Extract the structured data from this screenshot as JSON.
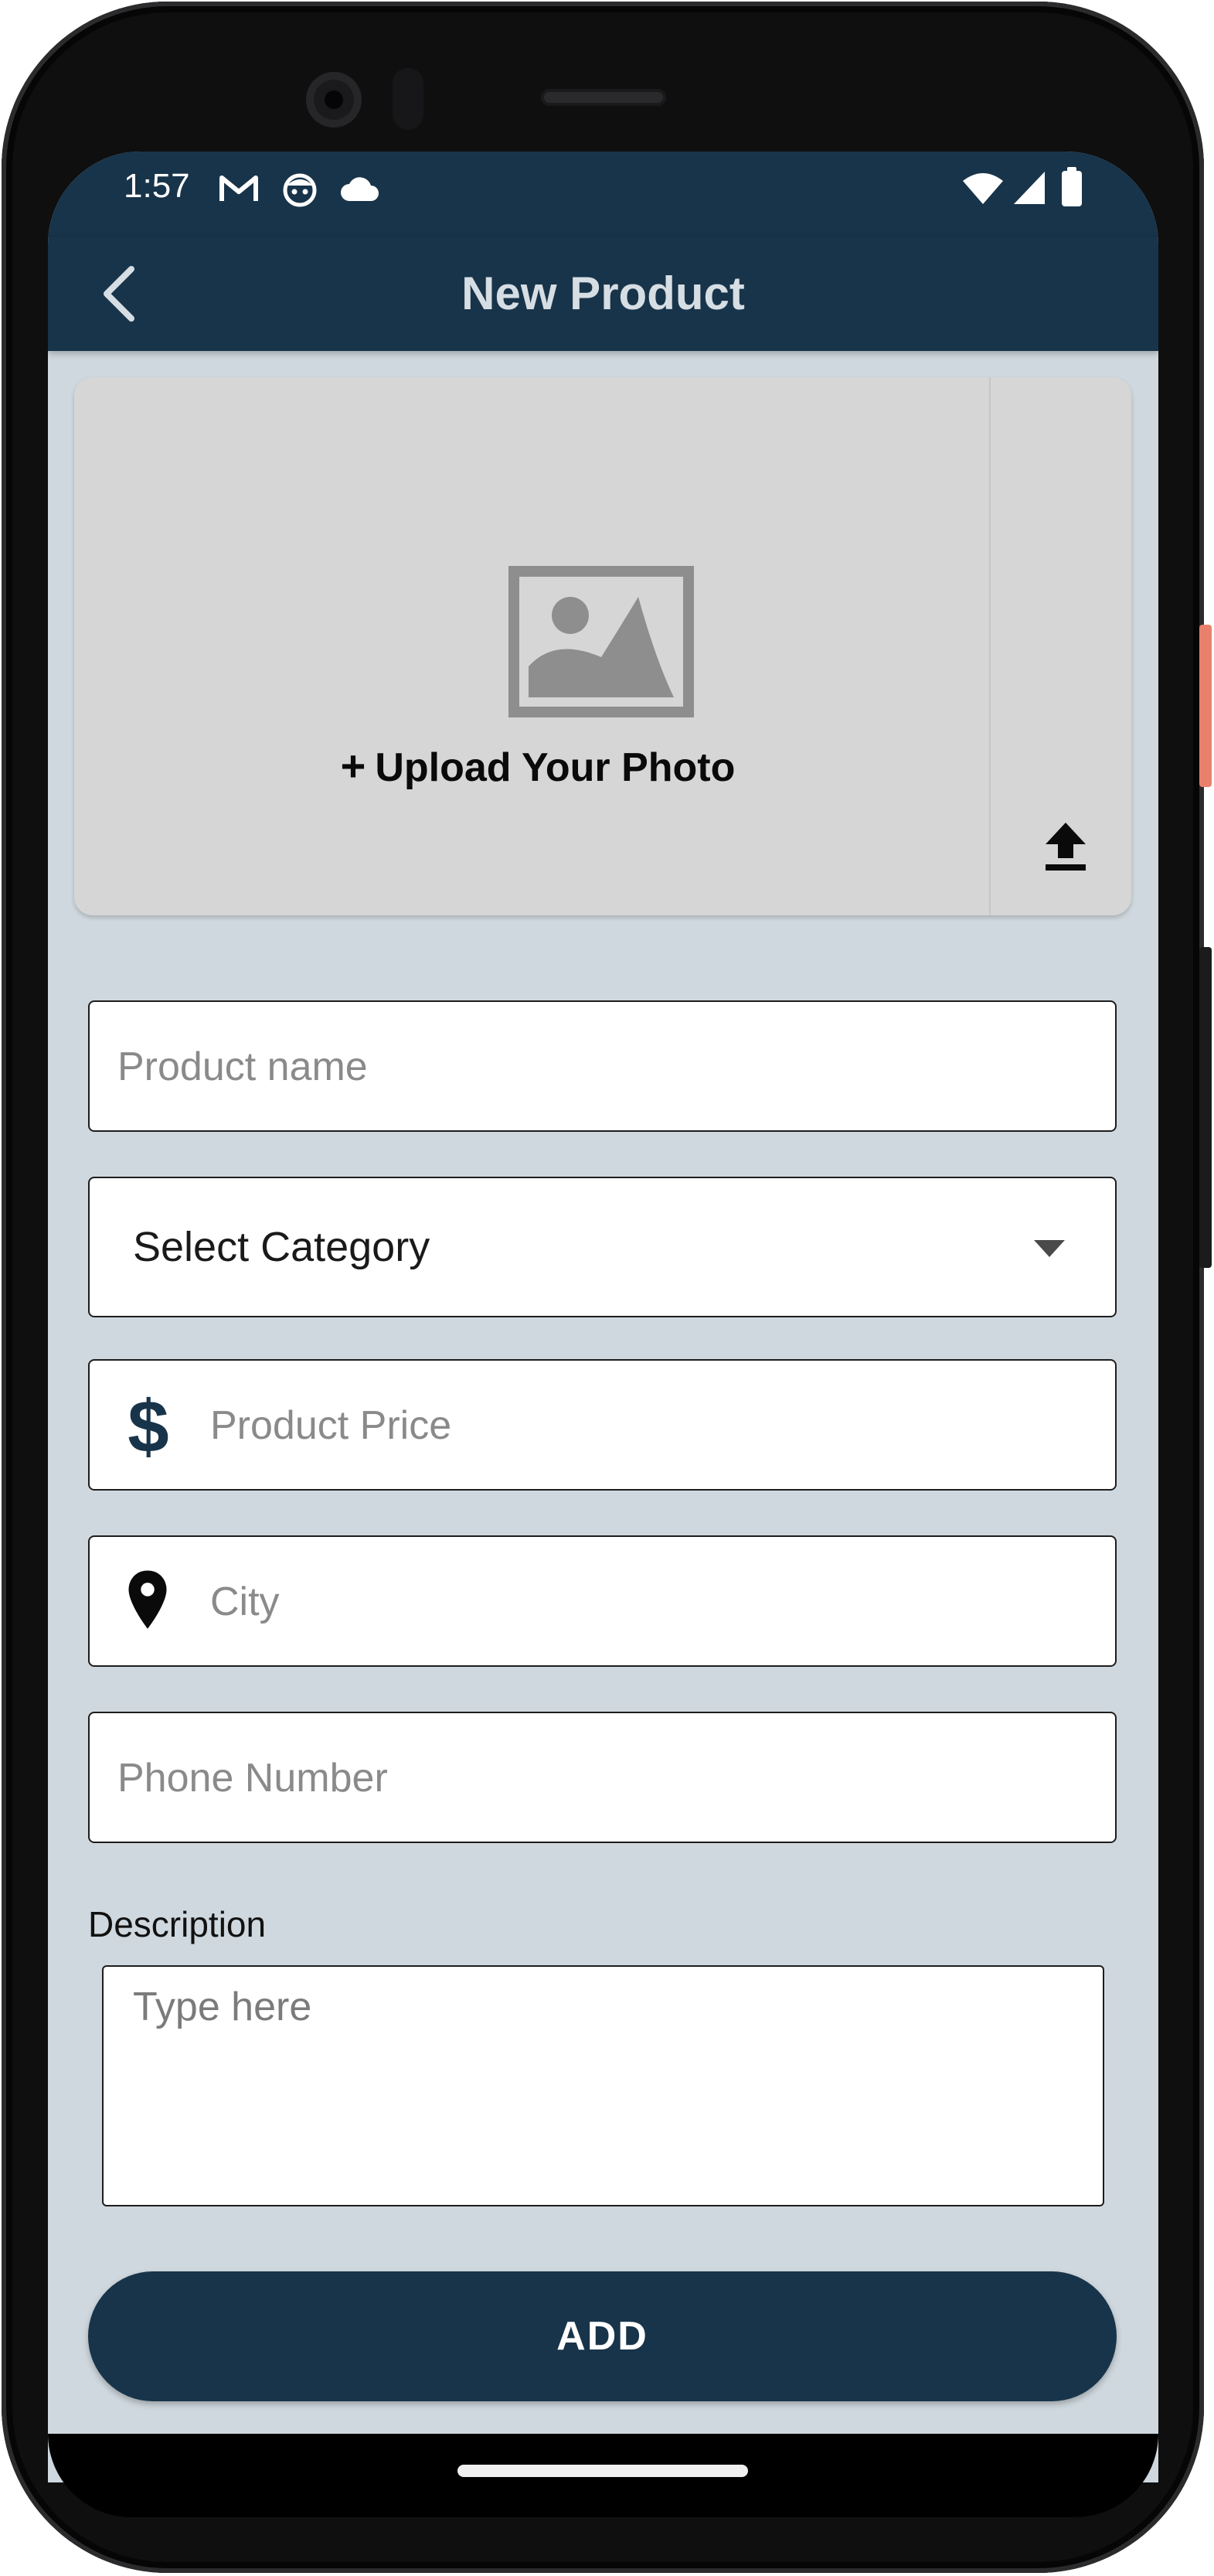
{
  "status_bar": {
    "time": "1:57",
    "left_icons": [
      "gmail-icon",
      "bot-face-icon",
      "cloud-icon"
    ],
    "right_icons": [
      "wifi-icon",
      "cell-signal-icon",
      "battery-icon"
    ]
  },
  "app_bar": {
    "title": "New Product",
    "back_icon": "chevron-left-icon"
  },
  "upload": {
    "label": "Upload Your Photo",
    "plus": "+",
    "image_icon": "image-placeholder-icon",
    "action_icon": "upload-arrow-icon"
  },
  "form": {
    "product_name": {
      "value": "",
      "placeholder": "Product name"
    },
    "category": {
      "selected": "Select Category",
      "icon": "dropdown-arrow-icon"
    },
    "price": {
      "value": "",
      "placeholder": "Product Price",
      "icon": "dollar-icon"
    },
    "city": {
      "value": "",
      "placeholder": "City",
      "icon": "location-pin-icon"
    },
    "phone": {
      "value": "",
      "placeholder": "Phone Number"
    },
    "description": {
      "label": "Description",
      "value": "",
      "placeholder": "Type here"
    },
    "submit_label": "ADD"
  },
  "colors": {
    "primary": "#18344a",
    "background": "#cfd8de",
    "card": "#d6d6d6",
    "title_text": "#d6dee4"
  }
}
